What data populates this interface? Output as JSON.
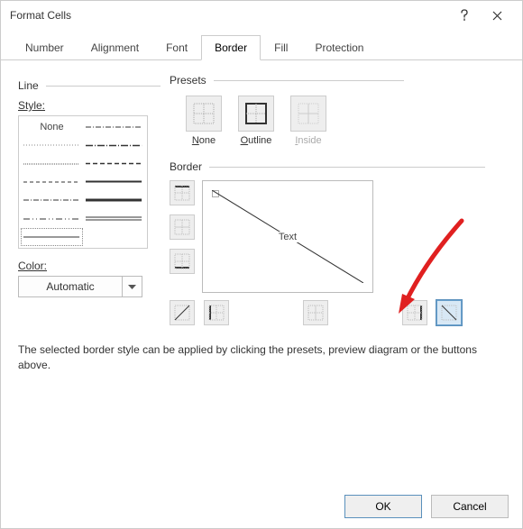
{
  "title": "Format Cells",
  "tabs": [
    "Number",
    "Alignment",
    "Font",
    "Border",
    "Fill",
    "Protection"
  ],
  "active_tab": "Border",
  "line": {
    "group": "Line",
    "style_label": "Style:",
    "none_label": "None",
    "color_label": "Color:",
    "color_value": "Automatic"
  },
  "presets": {
    "group": "Presets",
    "none": "None",
    "outline": "Outline",
    "inside": "Inside"
  },
  "border": {
    "group": "Border",
    "preview_text": "Text"
  },
  "hint": "The selected border style can be applied by clicking the presets, preview diagram or the buttons above.",
  "buttons": {
    "ok": "OK",
    "cancel": "Cancel"
  },
  "colors": {
    "arrow": "#e02020"
  }
}
